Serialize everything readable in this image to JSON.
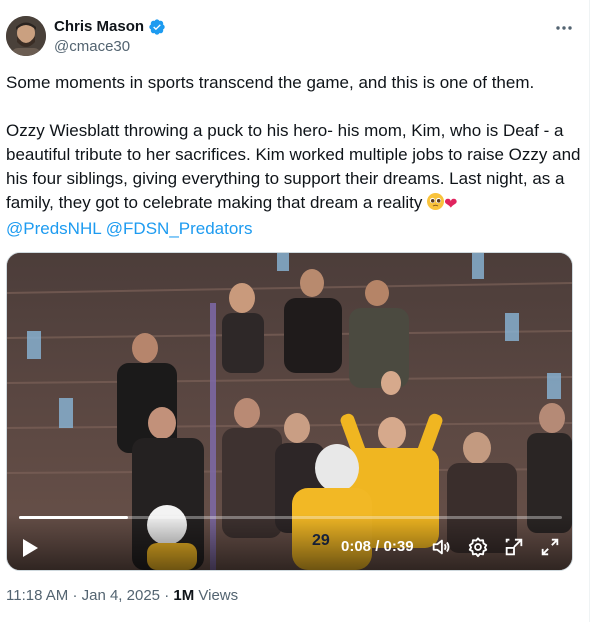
{
  "author": {
    "display_name": "Chris Mason",
    "handle": "@cmace30",
    "verified": true
  },
  "tweet": {
    "paragraph1": "Some moments in sports transcend the game, and this is one of them.",
    "paragraph2_text": "Ozzy Wiesblatt throwing a puck to his hero- his mom, Kim, who is Deaf - a beautiful tribute to her sacrifices. Kim worked multiple jobs to raise Ozzy and his four siblings, giving everything to support their dreams. Last night, as a family, they got to celebrate making that dream a reality ",
    "emojis": [
      "pleading-face",
      "red-heart"
    ],
    "mentions": [
      "@PredsNHL",
      "@FDSN_Predators"
    ]
  },
  "video": {
    "current_time": "0:08",
    "separator": "/",
    "duration": "0:39",
    "progress": 0.2,
    "jersey_number": "29",
    "controls": [
      "play-icon",
      "volume-icon",
      "settings-icon",
      "pip-icon",
      "fullscreen-icon"
    ]
  },
  "meta": {
    "time": "11:18 AM",
    "sep1": "·",
    "date": "Jan 4, 2025",
    "sep2": "·",
    "views_count": "1M",
    "views_label": "Views"
  },
  "colors": {
    "accent": "#1d9bf0",
    "text": "#0f1419",
    "muted": "#536471"
  }
}
